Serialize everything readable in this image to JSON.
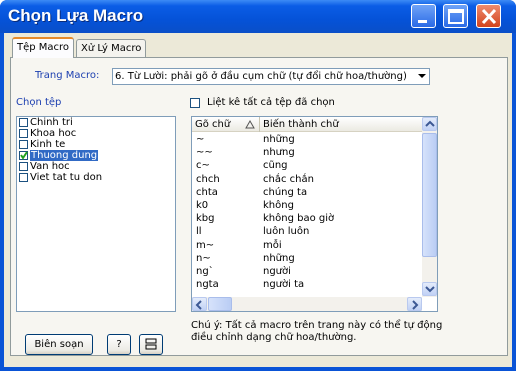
{
  "window": {
    "title": "Chọn Lựa Macro"
  },
  "tabs": [
    {
      "label": "Tệp Macro"
    },
    {
      "label": "Xử Lý Macro"
    }
  ],
  "page_select": {
    "label": "Trang Macro:",
    "value": "6. Từ Lười: phải gõ ở đầu cụm chữ (tự đổi chữ hoa/thường)"
  },
  "file_section": {
    "label": "Chọn tệp"
  },
  "files": [
    {
      "label": "Chinh tri",
      "checked": false
    },
    {
      "label": "Khoa hoc",
      "checked": false
    },
    {
      "label": "Kinh te",
      "checked": false
    },
    {
      "label": "Thuong dung",
      "checked": true
    },
    {
      "label": "Van hoc",
      "checked": false
    },
    {
      "label": "Viet tat tu don",
      "checked": false
    }
  ],
  "list_all_checkbox": {
    "label": "Liệt kê tất cả tệp đã chọn",
    "checked": false
  },
  "table": {
    "columns": [
      "Gõ chữ",
      "Biến thành chữ"
    ],
    "rows": [
      {
        "key": "~",
        "value": "những"
      },
      {
        "key": "~~",
        "value": "nhưng"
      },
      {
        "key": "c~",
        "value": "cũng"
      },
      {
        "key": "chch",
        "value": "chắc chắn"
      },
      {
        "key": "chta",
        "value": "chúng ta"
      },
      {
        "key": "k0",
        "value": "không"
      },
      {
        "key": "kbg",
        "value": "không bao giờ"
      },
      {
        "key": "ll",
        "value": "luôn luôn"
      },
      {
        "key": "m~",
        "value": "mỗi"
      },
      {
        "key": "n~",
        "value": "những"
      },
      {
        "key": "ng`",
        "value": "người"
      },
      {
        "key": "ngta",
        "value": "người ta"
      }
    ]
  },
  "note": "Chú ý: Tất cả macro trên trang này có thể tự động điều chỉnh dạng chữ hoa/thường.",
  "buttons": {
    "edit": "Biên soạn",
    "help": "?"
  },
  "colors": {
    "title_bar": "#0552d8",
    "selection": "#316ac5",
    "label_blue": "#1c3fb0",
    "close_button": "#d2431d"
  }
}
